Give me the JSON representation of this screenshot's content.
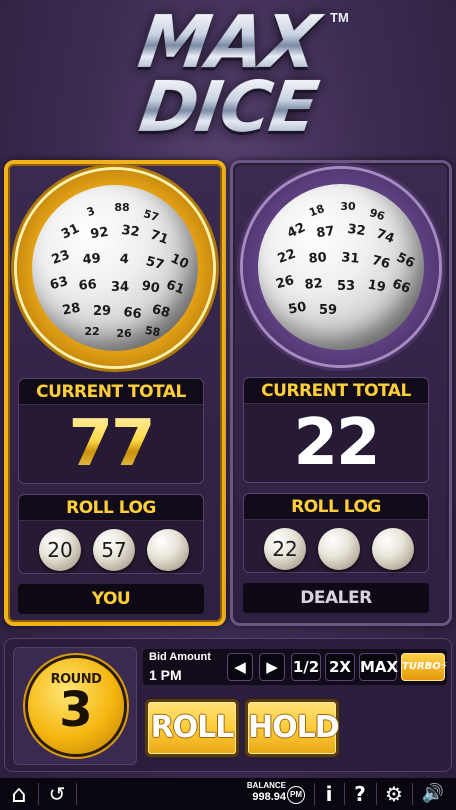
{
  "game": {
    "logo_line1": "MAX",
    "logo_line2": "DICE",
    "logo_tm": "TM"
  },
  "player": {
    "current_total_label": "CURRENT TOTAL",
    "current_total": "77",
    "roll_log_label": "ROLL LOG",
    "roll_log": [
      "20",
      "57",
      ""
    ],
    "name": "YOU",
    "die_numbers": [
      "3",
      "88",
      "57",
      "31",
      "92",
      "32",
      "71",
      "23",
      "49",
      "4",
      "57",
      "10",
      "63",
      "66",
      "34",
      "90",
      "61",
      "28",
      "29",
      "66",
      "68",
      "22",
      "26",
      "58"
    ]
  },
  "dealer": {
    "current_total_label": "CURRENT TOTAL",
    "current_total": "22",
    "roll_log_label": "ROLL LOG",
    "roll_log": [
      "22",
      "",
      ""
    ],
    "name": "DEALER",
    "die_numbers": [
      "18",
      "30",
      "96",
      "42",
      "87",
      "32",
      "74",
      "22",
      "80",
      "31",
      "76",
      "56",
      "26",
      "82",
      "53",
      "19",
      "66",
      "50",
      "59"
    ]
  },
  "controls": {
    "round_label": "ROUND",
    "round_value": "3",
    "bid_label": "Bid Amount",
    "bid_value": "1 PM",
    "prev_icon": "◀",
    "next_icon": "▶",
    "half_label": "1/2",
    "double_label": "2X",
    "max_label": "MAX",
    "turbo_label": "TURBO",
    "roll_label": "ROLL",
    "hold_label": "HOLD"
  },
  "footer": {
    "home_icon": "⌂",
    "history_icon": "↺",
    "balance_label": "BALANCE",
    "balance_value": "998.94",
    "currency": "PM",
    "info_icon": "i",
    "help_icon": "?",
    "settings_icon": "⚙",
    "sound_icon": "🔊"
  },
  "colors": {
    "accent_gold": "#f2b21c",
    "label_gold": "#ffcf3a",
    "panel_purple": "#3a2a4f"
  }
}
